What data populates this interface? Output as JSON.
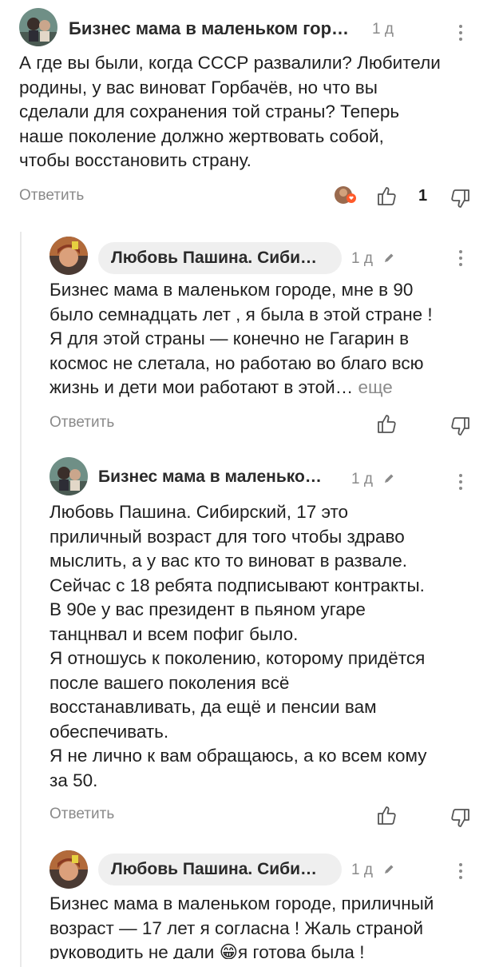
{
  "comments": [
    {
      "author": "Бизнес мама в маленьком гор…",
      "time": "1 д",
      "text": "А где вы были, когда СССР развалили? Любители\nродины, у вас виноват Горбачёв, но что вы\nсделали для сохранения той страны? Теперь\nнаше поколение должно жертвовать собой,\nчтобы восстановить страну.",
      "reply_label": "Ответить",
      "likes": "1"
    },
    {
      "author": "Любовь Пашина. Сиби…",
      "time": "1 д",
      "text": "Бизнес мама в маленьком городе, мне в 90\nбыло семнадцать лет , я была в этой стране !\nЯ для этой страны — конечно не Гагарин в\nкосмос не слетала, но работаю во благо всю\nжизнь и дети мои работают в этой… ",
      "more_label": "еще",
      "reply_label": "Ответить"
    },
    {
      "author": "Бизнес мама в маленько…",
      "time": "1 д",
      "text": "Любовь Пашина. Сибирский, 17 это\nприличный возраст для того чтобы здраво\nмыслить, а у вас кто то виноват в развале.\nСейчас с 18 ребята подписывают контракты.\nВ 90е у вас президент в пьяном угаре\nтанцнвал и всем пофиг было.\nЯ отношусь к поколению, которому придётся\nпосле вашего поколения всё\nвосстанавливать, да ещё и пенсии вам\nобеспечивать.\nЯ не лично к вам обращаюсь, а ко всем кому\nза 50.",
      "reply_label": "Ответить"
    },
    {
      "author": "Любовь Пашина. Сиби…",
      "time": "1 д",
      "text": "Бизнес мама в маленьком городе, приличный\nвозраст — 17 лет я согласна ! Жаль страной\nруководить не дали 😁я готова была !"
    }
  ]
}
